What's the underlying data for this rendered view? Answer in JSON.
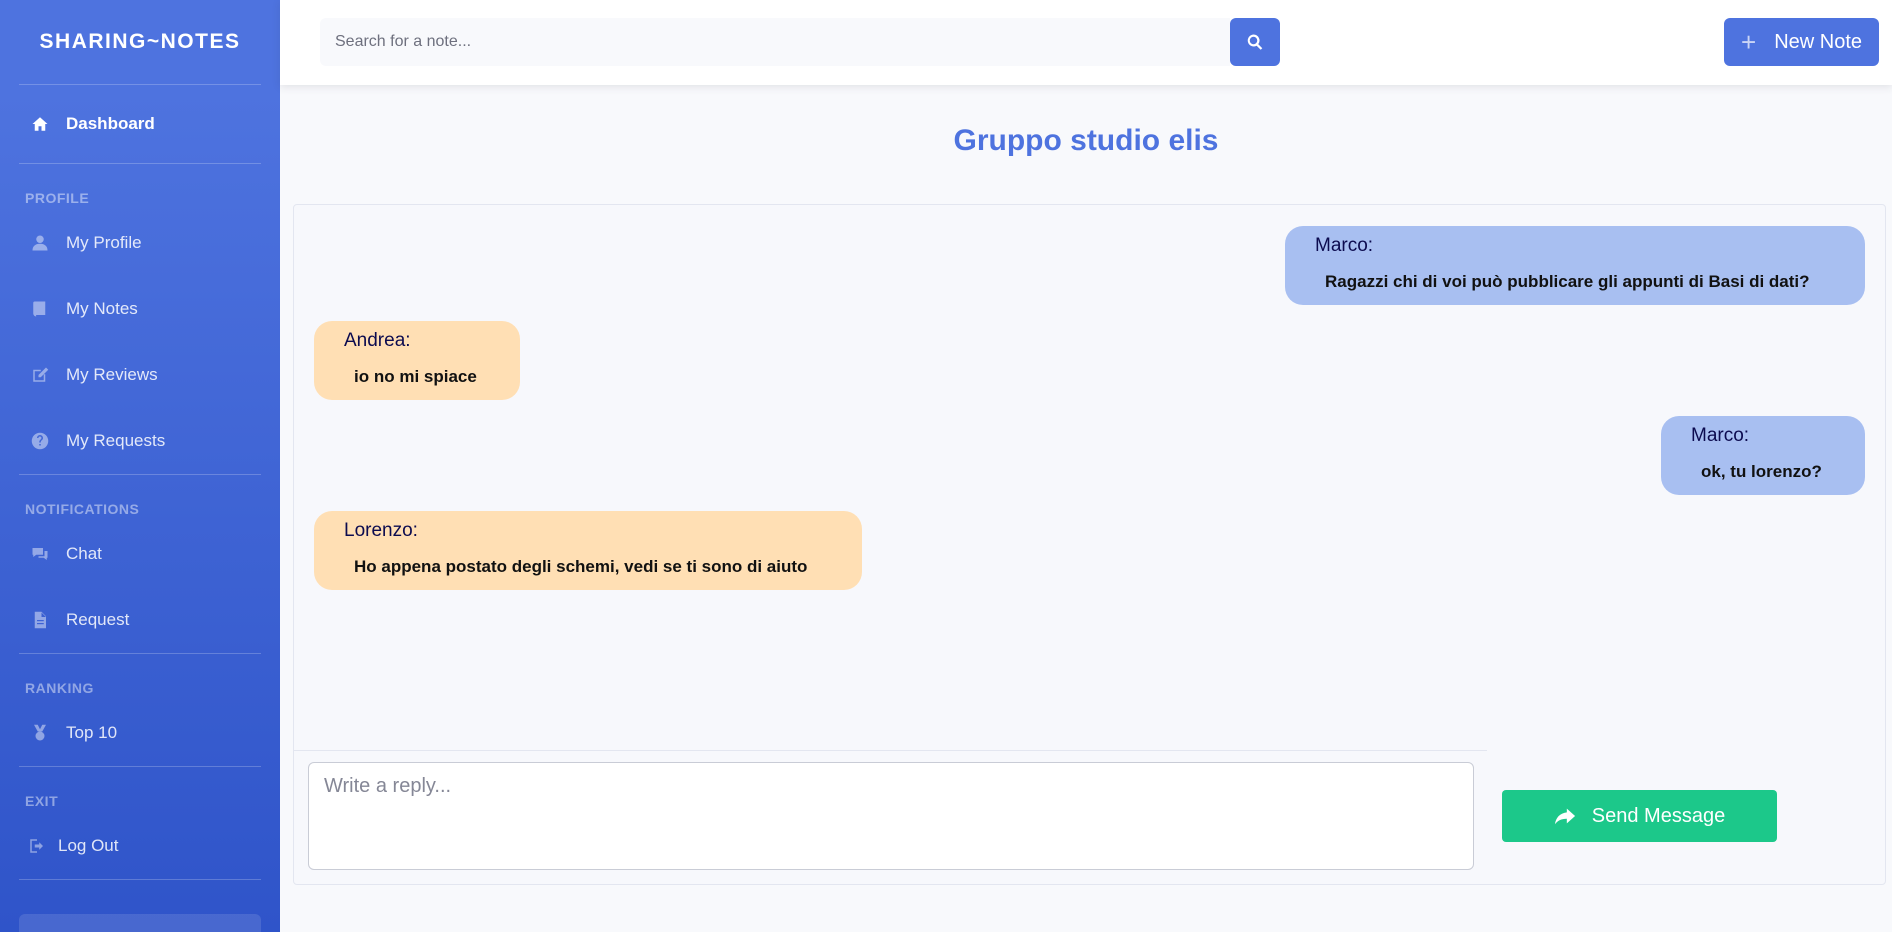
{
  "brand": "SHARING~NOTES",
  "sidebar": {
    "dashboard": {
      "label": "Dashboard",
      "icon": "home-icon"
    },
    "sections": [
      {
        "heading": "PROFILE",
        "items": [
          {
            "label": "My Profile",
            "icon": "user-icon"
          },
          {
            "label": "My Notes",
            "icon": "book-icon"
          },
          {
            "label": "My Reviews",
            "icon": "edit-icon"
          },
          {
            "label": "My Requests",
            "icon": "question-circle-icon"
          }
        ]
      },
      {
        "heading": "NOTIFICATIONS",
        "items": [
          {
            "label": "Chat",
            "icon": "comments-icon"
          },
          {
            "label": "Request",
            "icon": "file-icon"
          }
        ]
      },
      {
        "heading": "RANKING",
        "items": [
          {
            "label": "Top 10",
            "icon": "medal-icon"
          }
        ]
      },
      {
        "heading": "EXIT",
        "items": [
          {
            "label": "Log Out",
            "icon": "sign-out-icon"
          }
        ]
      }
    ]
  },
  "topbar": {
    "search_placeholder": "Search for a note...",
    "new_note_label": "New Note"
  },
  "chat": {
    "title": "Gruppo studio elis",
    "messages": [
      {
        "author": "Marco:",
        "text": "Ragazzi chi di voi può pubblicare gli appunti di Basi di dati?",
        "side": "right"
      },
      {
        "author": "Andrea:",
        "text": "io no mi spiace",
        "side": "left"
      },
      {
        "author": "Marco:",
        "text": "ok, tu lorenzo?",
        "side": "right"
      },
      {
        "author": "Lorenzo:",
        "text": "Ho appena postato degli schemi, vedi se ti sono di aiuto",
        "side": "left"
      }
    ],
    "reply_placeholder": "Write a reply...",
    "send_label": "Send Message"
  },
  "colors": {
    "primary": "#4e73df",
    "success": "#1cc88a",
    "bubble_mine": "#a8bff1",
    "bubble_theirs": "#ffdfb4"
  }
}
